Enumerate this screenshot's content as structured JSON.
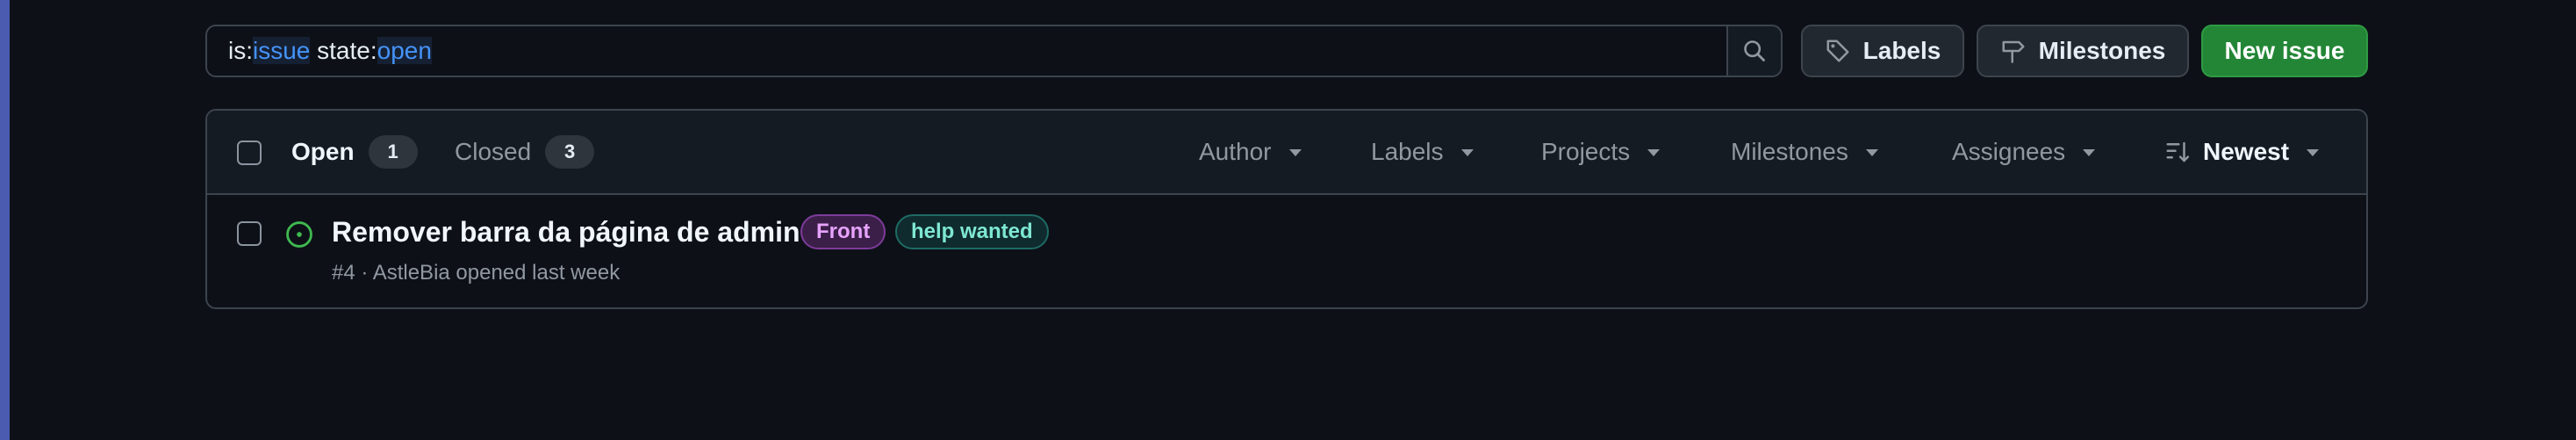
{
  "search": {
    "prefix1": "is:",
    "token1": "issue",
    "prefix2": " state:",
    "token2": "open"
  },
  "toolbar": {
    "labels_button": "Labels",
    "milestones_button": "Milestones",
    "new_issue_button": "New issue"
  },
  "tabs": {
    "open_label": "Open",
    "open_count": "1",
    "closed_label": "Closed",
    "closed_count": "3"
  },
  "filters": {
    "author": "Author",
    "labels": "Labels",
    "projects": "Projects",
    "milestones": "Milestones",
    "assignees": "Assignees",
    "sort": "Newest"
  },
  "issues": [
    {
      "title": "Remover barra da página de admin",
      "labels": [
        {
          "name": "Front",
          "color": "#e7a3ff"
        },
        {
          "name": "help wanted",
          "color": "#7ee7d3"
        }
      ],
      "meta": "#4 · AstleBia opened last week"
    }
  ],
  "colors": {
    "background": "#0d1117",
    "accent_green": "#238636",
    "open_icon": "#3fb950",
    "link_blue": "#4493f8"
  },
  "icons": {
    "search": "search-icon",
    "labels": "tag-icon",
    "milestones": "milestone-icon",
    "sort": "sort-icon",
    "issue_state": "issue-opened-icon"
  }
}
